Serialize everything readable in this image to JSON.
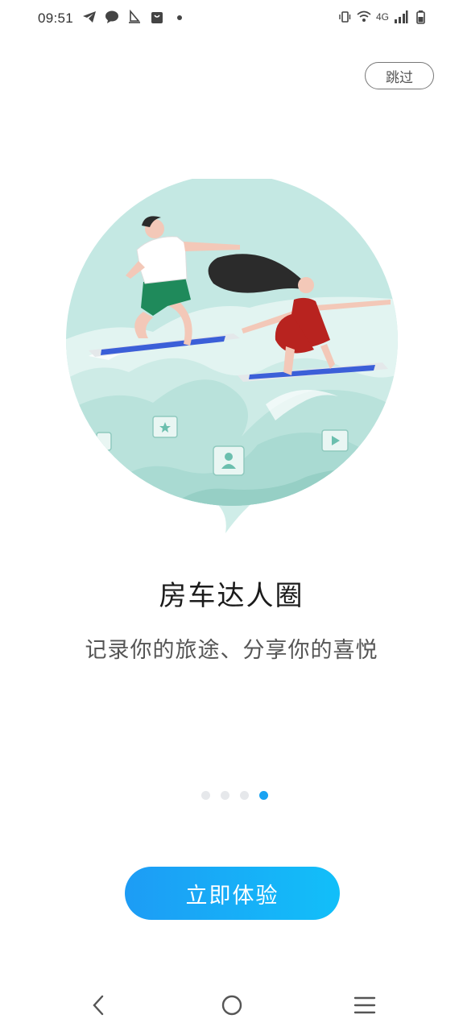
{
  "status_bar": {
    "time": "09:51",
    "network": "4G",
    "left_icons": [
      "telegram-icon",
      "chat-bubble-icon",
      "sailboat-icon",
      "shopping-bag-icon",
      "notification-dot-icon"
    ],
    "right_icons": [
      "vibrate-icon",
      "wifi-icon",
      "signal-icon",
      "battery-icon"
    ]
  },
  "skip_label": "跳过",
  "onboarding": {
    "title": "房车达人圈",
    "subtitle": "记录你的旅途、分享你的喜悦",
    "page_count": 4,
    "active_index": 3
  },
  "cta_label": "立即体验",
  "nav_bar": {
    "icons": [
      "back-icon",
      "home-icon",
      "menu-icon"
    ]
  },
  "colors": {
    "accent": "#1aa3f2",
    "cta_start": "#1d9cf5",
    "cta_end": "#12bff9",
    "illustration_teal": "#c4e8e3",
    "phone_screen": "#3b5fd8",
    "dress_red": "#b8231f"
  }
}
